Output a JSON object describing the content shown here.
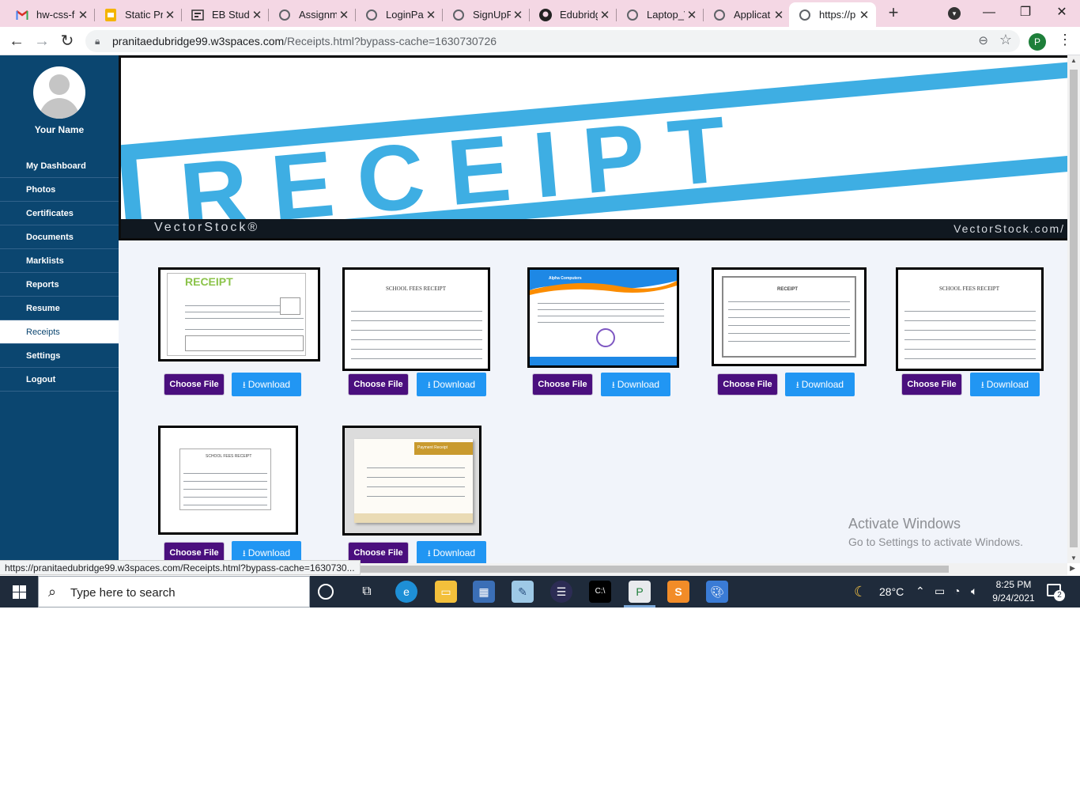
{
  "browser": {
    "tabs": [
      {
        "label": "hw-css-f",
        "icon": "gmail-icon"
      },
      {
        "label": "Static Pr",
        "icon": "slides-icon"
      },
      {
        "label": "EB Stude",
        "icon": "classroom-icon"
      },
      {
        "label": "Assignm",
        "icon": "globe-icon"
      },
      {
        "label": "LoginPag",
        "icon": "globe-icon"
      },
      {
        "label": "SignUpP",
        "icon": "globe-icon"
      },
      {
        "label": "Edubridg",
        "icon": "github-icon"
      },
      {
        "label": "Laptop_V",
        "icon": "globe-icon"
      },
      {
        "label": "Applicat",
        "icon": "globe-icon"
      },
      {
        "label": "https://p",
        "icon": "globe-icon",
        "active": true
      }
    ],
    "url_domain": "pranitaedubridge99.w3spaces.com",
    "url_path": "/Receipts.html?bypass-cache=1630730726",
    "profile_initial": "P",
    "status_url": "https://pranitaedubridge99.w3spaces.com/Receipts.html?bypass-cache=1630730..."
  },
  "sidebar": {
    "user_name": "Your Name",
    "items": [
      {
        "label": "My Dashboard"
      },
      {
        "label": "Photos"
      },
      {
        "label": "Certificates"
      },
      {
        "label": "Documents"
      },
      {
        "label": "Marklists"
      },
      {
        "label": "Reports"
      },
      {
        "label": "Resume"
      },
      {
        "label": "Receipts",
        "active": true
      },
      {
        "label": "Settings"
      },
      {
        "label": "Logout"
      }
    ]
  },
  "banner": {
    "word": "RECEIPT",
    "brand_left": "VectorStock®",
    "brand_right": "VectorStock.com/"
  },
  "receipts": [
    {
      "choose_label": "Choose File",
      "download_label": "Download",
      "thumb_title": "RECEIPT"
    },
    {
      "choose_label": "Choose File",
      "download_label": "Download",
      "thumb_title": "SCHOOL FEES RECEIPT"
    },
    {
      "choose_label": "Choose File",
      "download_label": "Download",
      "thumb_title": "Alpha Computers"
    },
    {
      "choose_label": "Choose File",
      "download_label": "Download",
      "thumb_title": "RECEIPT"
    },
    {
      "choose_label": "Choose File",
      "download_label": "Download",
      "thumb_title": "SCHOOL FEES RECEIPT"
    },
    {
      "choose_label": "Choose File",
      "download_label": "Download",
      "thumb_title": "SCHOOL FEES RECEIPT"
    },
    {
      "choose_label": "Choose File",
      "download_label": "Download",
      "thumb_title": "Payment Receipt"
    }
  ],
  "watermark": {
    "line1": "Activate Windows",
    "line2": "Go to Settings to activate Windows."
  },
  "taskbar": {
    "search_placeholder": "Type here to search",
    "temperature": "28°C",
    "time": "8:25 PM",
    "date": "9/24/2021",
    "notification_count": "2"
  },
  "colors": {
    "sidebar_bg": "#0b4670",
    "choose_btn": "#4a0f7e",
    "download_btn": "#2196f3",
    "banner_blue": "#3eaee3",
    "tab_strip": "#f4d7e4"
  }
}
